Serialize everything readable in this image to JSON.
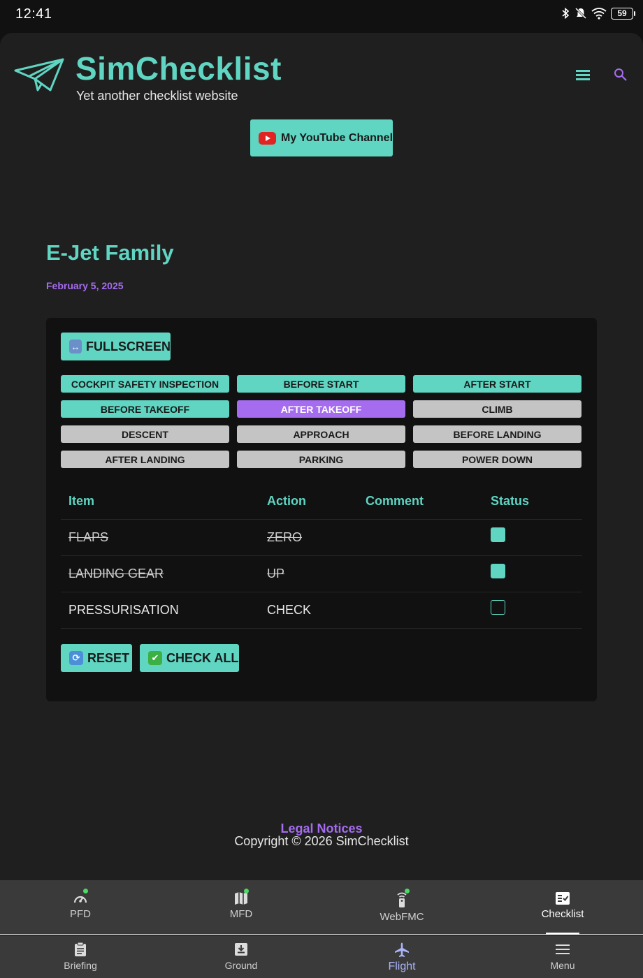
{
  "status_bar": {
    "time": "12:41",
    "battery": "59"
  },
  "header": {
    "title": "SimChecklist",
    "tagline": "Yet another checklist website",
    "youtube_label": "My YouTube Channel"
  },
  "page": {
    "title": "E-Jet Family",
    "date": "February 5, 2025"
  },
  "checklist": {
    "fullscreen_label": "FULLSCREEN",
    "phases": [
      {
        "label": "COCKPIT SAFETY INSPECTION",
        "state": "done"
      },
      {
        "label": "BEFORE START",
        "state": "done"
      },
      {
        "label": "AFTER START",
        "state": "done"
      },
      {
        "label": "BEFORE TAKEOFF",
        "state": "done"
      },
      {
        "label": "AFTER TAKEOFF",
        "state": "current"
      },
      {
        "label": "CLIMB",
        "state": "todo"
      },
      {
        "label": "DESCENT",
        "state": "todo"
      },
      {
        "label": "APPROACH",
        "state": "todo"
      },
      {
        "label": "BEFORE LANDING",
        "state": "todo"
      },
      {
        "label": "AFTER LANDING",
        "state": "todo"
      },
      {
        "label": "PARKING",
        "state": "todo"
      },
      {
        "label": "POWER DOWN",
        "state": "todo"
      }
    ],
    "columns": [
      "Item",
      "Action",
      "Comment",
      "Status"
    ],
    "rows": [
      {
        "item": "FLAPS",
        "action": "ZERO",
        "comment": "",
        "checked": true
      },
      {
        "item": "LANDING GEAR",
        "action": "UP",
        "comment": "",
        "checked": true
      },
      {
        "item": "PRESSURISATION",
        "action": "CHECK",
        "comment": "",
        "checked": false
      }
    ],
    "reset_label": "RESET",
    "check_all_label": "CHECK ALL"
  },
  "footer": {
    "copyright": "Copyright © 2026 SimChecklist",
    "legal": "Legal Notices"
  },
  "nav_primary": [
    {
      "label": "PFD",
      "icon": "speedometer-icon",
      "dot": true
    },
    {
      "label": "MFD",
      "icon": "map-icon",
      "dot": true
    },
    {
      "label": "WebFMC",
      "icon": "fmc-remote-icon",
      "dot": true
    },
    {
      "label": "Checklist",
      "icon": "checklist-icon",
      "active": true
    }
  ],
  "nav_secondary": [
    {
      "label": "Briefing",
      "icon": "clipboard-icon"
    },
    {
      "label": "Ground",
      "icon": "ground-download-icon"
    },
    {
      "label": "Flight",
      "icon": "airplane-icon"
    },
    {
      "label": "Menu",
      "icon": "hamburger-icon"
    }
  ],
  "colors": {
    "accent": "#5fd5c2",
    "purple": "#a56cf0",
    "grey": "#c4c4c4",
    "background": "#1f1f1f"
  }
}
